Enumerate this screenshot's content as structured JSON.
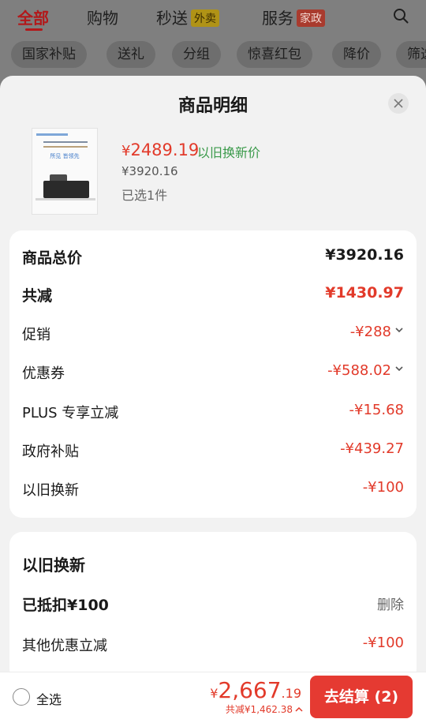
{
  "topnav": {
    "tabs": [
      {
        "label": "全部",
        "badge": ""
      },
      {
        "label": "购物",
        "badge": ""
      },
      {
        "label": "秒送",
        "badge": "外卖"
      },
      {
        "label": "服务",
        "badge": "家政"
      }
    ]
  },
  "subnav": {
    "chips": [
      "国家补贴",
      "送礼",
      "分组",
      "惊喜红包",
      "降价",
      "筛选"
    ]
  },
  "sheet": {
    "title": "商品明细",
    "product": {
      "thumb_text": "所见 皆领先",
      "price_now_symbol": "¥",
      "price_now": "2489.19",
      "tradein_label": "以旧换新价",
      "price_old": "¥3920.16",
      "selected": "已选1件"
    },
    "summary": {
      "total_label": "商品总价",
      "total_value": "¥3920.16",
      "reduce_label": "共减",
      "reduce_value": "¥1430.97",
      "promo_label": "促销",
      "promo_value": "-¥288",
      "coupon_label": "优惠券",
      "coupon_value": "-¥588.02",
      "plus_label": "PLUS 专享立减",
      "plus_value": "-¥15.68",
      "subsidy_label": "政府补贴",
      "subsidy_value": "-¥439.27",
      "tradein_label": "以旧换新",
      "tradein_value": "-¥100"
    },
    "tradein_card": {
      "title": "以旧换新",
      "deducted_label": "已抵扣¥100",
      "delete_label": "删除",
      "other_label": "其他优惠立减",
      "other_value": "-¥100"
    }
  },
  "bottom": {
    "select_all": "全选",
    "total_symbol": "¥",
    "total_int": "2,667",
    "total_dec": ".19",
    "saved": "共减¥1,462.38",
    "checkout_label": "去结算 (2)"
  },
  "colors": {
    "accent_red": "#e23a2a",
    "tradein_green": "#3a9a4a",
    "checkout_red": "#e53a32"
  }
}
